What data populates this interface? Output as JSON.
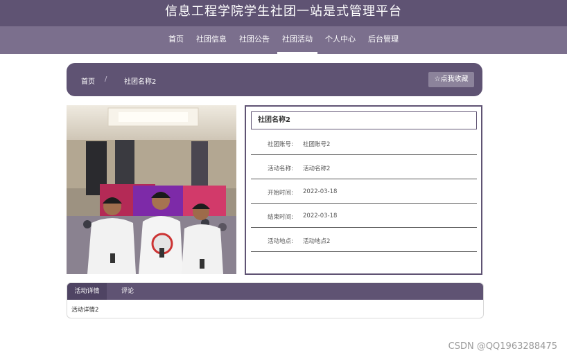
{
  "header": {
    "title": "信息工程学院学生社团一站是式管理平台"
  },
  "nav": {
    "items": [
      "首页",
      "社团信息",
      "社团公告",
      "社团活动",
      "个人中心",
      "后台管理"
    ],
    "active_index": 3
  },
  "breadcrumb": {
    "home": "首页",
    "separator": "/",
    "current": "社团名称2"
  },
  "favorite_button": "☆点我收藏",
  "detail": {
    "name": "社团名称2",
    "rows": [
      {
        "label": "社团账号:",
        "value": "社团账号2"
      },
      {
        "label": "活动名称:",
        "value": "活动名称2"
      },
      {
        "label": "开始时间:",
        "value": "2022-03-18"
      },
      {
        "label": "结束时间:",
        "value": "2022-03-18"
      },
      {
        "label": "活动地点:",
        "value": "活动地点2"
      }
    ]
  },
  "tabs": {
    "items": [
      "活动详情",
      "评论"
    ],
    "active_index": 0,
    "content": "活动详情2"
  },
  "watermark": "CSDN @QQ1963288475",
  "colors": {
    "primary": "#5f5373",
    "nav": "#7b6f8d",
    "button": "#8c839b"
  }
}
